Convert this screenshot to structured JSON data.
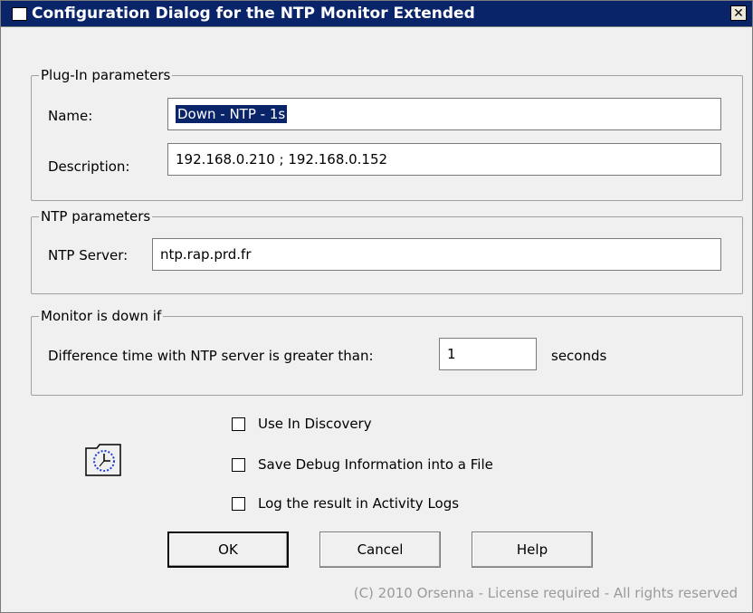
{
  "window": {
    "title": "Configuration Dialog for the NTP Monitor Extended",
    "close_label": "✕"
  },
  "plugin_params": {
    "legend": "Plug-In parameters",
    "name_label": "Name:",
    "name_value": "Down - NTP - 1s",
    "description_label": "Description:",
    "description_value": "192.168.0.210 ; 192.168.0.152"
  },
  "ntp_params": {
    "legend": "NTP parameters",
    "server_label": "NTP Server:",
    "server_value": "ntp.rap.prd.fr"
  },
  "monitor": {
    "legend": "Monitor is down if",
    "difference_label": "Difference time with NTP server is greater than:",
    "difference_value": "1",
    "unit_label": "seconds"
  },
  "options": [
    {
      "label": "Use In Discovery",
      "checked": false
    },
    {
      "label": "Save Debug Information into a File",
      "checked": false
    },
    {
      "label": "Log the result in Activity Logs",
      "checked": false
    }
  ],
  "buttons": {
    "ok": "OK",
    "cancel": "Cancel",
    "help": "Help"
  },
  "footer": {
    "copyright": "(C) 2010 Orsenna - License required - All rights reserved"
  },
  "icons": {
    "title_icon": "plugin-icon",
    "dialog_icon": "clock-folder-icon"
  }
}
